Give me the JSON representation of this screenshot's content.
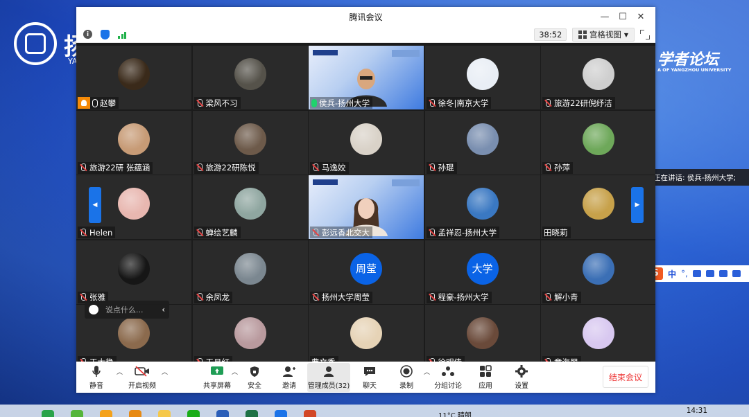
{
  "window": {
    "title": "腾讯会议",
    "timer": "38:52",
    "view_mode": "宫格视图"
  },
  "background": {
    "left_char": "扬",
    "left_sub": "YA",
    "right_title": "学者论坛",
    "right_sub": "A OF YANGZHOU UNIVERSITY"
  },
  "speaking": {
    "label": "正在讲话: 侯兵-扬州大学;"
  },
  "participants": [
    {
      "name": "赵攀",
      "avatar": "photo-night-pagoda",
      "color": "#3a2a1a",
      "mic": "on",
      "host": true
    },
    {
      "name": "梁风不习",
      "avatar": "photo-dusk",
      "color": "#55524a",
      "mic": "off"
    },
    {
      "name": "侯兵-扬州大学",
      "avatar": "video-slide-man",
      "color": "#2d6ad8",
      "mic": "speaking",
      "video": true
    },
    {
      "name": "徐冬|南京大学",
      "avatar": "photo-suit-man",
      "color": "#e9eef5",
      "mic": "off"
    },
    {
      "name": "旅游22研倪纾洁",
      "avatar": "photo-anime-girl",
      "color": "#cfcfcf",
      "mic": "off"
    },
    {
      "name": "旅游22研 张蕴涵",
      "avatar": "photo-teddy-bear",
      "color": "#c79b76",
      "mic": "off"
    },
    {
      "name": "旅游22研陈悦",
      "avatar": "photo-group",
      "color": "#6d5a4a",
      "mic": "off"
    },
    {
      "name": "马逸姣",
      "avatar": "photo-girl-light",
      "color": "#d9d2c8",
      "mic": "off"
    },
    {
      "name": "孙琨",
      "avatar": "photo-river-bridge",
      "color": "#7a8fb0",
      "mic": "off"
    },
    {
      "name": "孙萍",
      "avatar": "photo-green-tree",
      "color": "#6ea85a",
      "mic": "off"
    },
    {
      "name": "Helen",
      "avatar": "photo-cartoon-cat",
      "color": "#e8b7b0",
      "mic": "off"
    },
    {
      "name": "蝉绘艺麟",
      "avatar": "photo-misty-forest",
      "color": "#8fa6a0",
      "mic": "off"
    },
    {
      "name": "彭远香北交大",
      "avatar": "video-slide-woman",
      "color": "#2d6ad8",
      "mic": "off",
      "video": true
    },
    {
      "name": "孟祥忍-扬州大学",
      "avatar": "photo-palace",
      "color": "#3a78c2",
      "mic": "off"
    },
    {
      "name": "田晓莉",
      "avatar": "photo-sunset-field",
      "color": "#c7a14a",
      "mic": "none"
    },
    {
      "name": "张雅",
      "avatar": "photo-crescent-moon",
      "color": "#161616",
      "mic": "off"
    },
    {
      "name": "余凤龙",
      "avatar": "photo-lake",
      "color": "#7b8790",
      "mic": "off"
    },
    {
      "name": "扬州大学周莹",
      "avatar": "text",
      "avatar_text": "周莹",
      "color": "#0a63e6",
      "mic": "off"
    },
    {
      "name": "程豪-扬州大学",
      "avatar": "text",
      "avatar_text": "大学",
      "color": "#0a63e6",
      "mic": "off"
    },
    {
      "name": "解小青",
      "avatar": "photo-mountain-lake",
      "color": "#3b6fb5",
      "mic": "off"
    },
    {
      "name": "王大稳",
      "avatar": "photo-couple",
      "color": "#8b6a4d",
      "mic": "off"
    },
    {
      "name": "王月红",
      "avatar": "photo-lady-pink",
      "color": "#b99a9e",
      "mic": "off"
    },
    {
      "name": "曹文秀",
      "avatar": "photo-cartoon-head",
      "color": "#e6d3b6",
      "mic": "none"
    },
    {
      "name": "徐明倩",
      "avatar": "photo-anime-girl2",
      "color": "#6a4a3a",
      "mic": "off"
    },
    {
      "name": "章海翠",
      "avatar": "photo-pastel-cartoon",
      "color": "#d8c8f0",
      "mic": "off"
    }
  ],
  "chat": {
    "placeholder": "说点什么..."
  },
  "toolbar": {
    "mute": "静音",
    "start_video": "开启视频",
    "share_screen": "共享屏幕",
    "security": "安全",
    "invite": "邀请",
    "members": "管理成员(32)",
    "chat": "聊天",
    "record": "录制",
    "breakout": "分组讨论",
    "apps": "应用",
    "settings": "设置",
    "end": "结束会议"
  },
  "ime": {
    "lang": "中"
  },
  "taskbar": {
    "weather": "11°C 晴朗",
    "time": "14:31"
  }
}
